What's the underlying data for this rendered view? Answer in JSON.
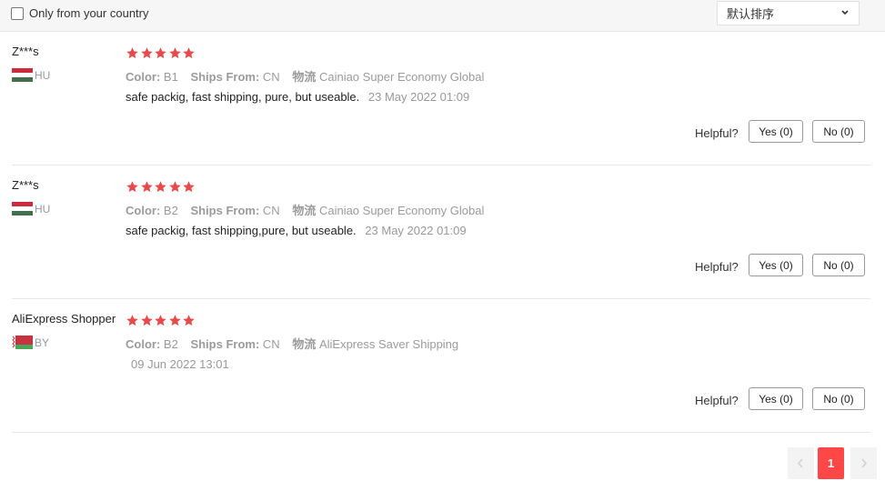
{
  "filters": {
    "country_only_label": "Only from your country",
    "sort_selected": "默认排序"
  },
  "colors": {
    "star": "#e84a4a",
    "accent": "#ff4747"
  },
  "helpful_label": "Helpful?",
  "reviews": [
    {
      "author": "Z***s",
      "country_code": "HU",
      "rating": 5,
      "color_label": "Color:",
      "color_value": "B1",
      "ships_label": "Ships From:",
      "ships_value": "CN",
      "logistics_label": "物流",
      "logistics_value": "Cainiao Super Economy Global",
      "text": "safe packig, fast shipping, pure, but useable.",
      "date": "23 May 2022 01:09",
      "yes": "Yes (0)",
      "no": "No (0)"
    },
    {
      "author": "Z***s",
      "country_code": "HU",
      "rating": 5,
      "color_label": "Color:",
      "color_value": "B2",
      "ships_label": "Ships From:",
      "ships_value": "CN",
      "logistics_label": "物流",
      "logistics_value": "Cainiao Super Economy Global",
      "text": "safe packig, fast shipping,pure, but useable.",
      "date": "23 May 2022 01:09",
      "yes": "Yes (0)",
      "no": "No (0)"
    },
    {
      "author": "AliExpress Shopper",
      "country_code": "BY",
      "rating": 5,
      "color_label": "Color:",
      "color_value": "B2",
      "ships_label": "Ships From:",
      "ships_value": "CN",
      "logistics_label": "物流",
      "logistics_value": "AliExpress Saver Shipping",
      "text": "",
      "date": "09 Jun 2022 13:01",
      "yes": "Yes (0)",
      "no": "No (0)"
    }
  ],
  "pagination": {
    "current_page": "1"
  }
}
